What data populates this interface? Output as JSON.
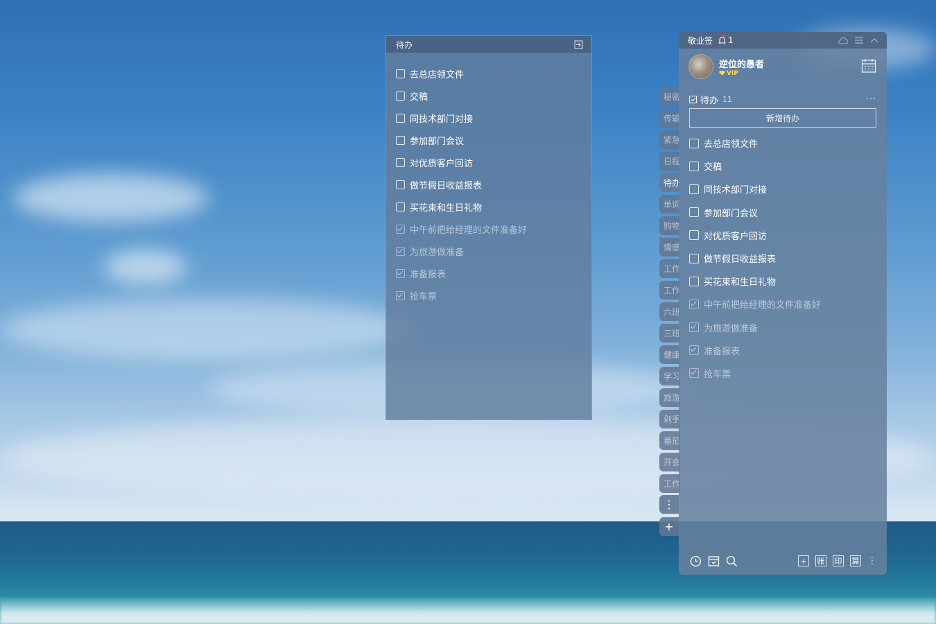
{
  "panel_float": {
    "title": "待办",
    "items": [
      {
        "text": "去总店领文件",
        "done": false
      },
      {
        "text": "交稿",
        "done": false
      },
      {
        "text": "同技术部门对接",
        "done": false
      },
      {
        "text": "参加部门会议",
        "done": false
      },
      {
        "text": "对优质客户回访",
        "done": false
      },
      {
        "text": "做节假日收益报表",
        "done": false
      },
      {
        "text": "买花束和生日礼物",
        "done": false
      },
      {
        "text": "中午前把给经理的文件准备好",
        "done": true
      },
      {
        "text": "为旅游做准备",
        "done": true
      },
      {
        "text": "准备报表",
        "done": true
      },
      {
        "text": "抢车票",
        "done": true
      }
    ]
  },
  "side_tabs": [
    "秘密",
    "传输",
    "紧急",
    "日程",
    "待办",
    "单词",
    "购物",
    "情感",
    "工作",
    "工作",
    "六班",
    "三班",
    "健康",
    "学习",
    "旅游",
    "剁手",
    "番茄",
    "开会",
    "工作"
  ],
  "side_tab_active": 4,
  "side_more": "⋮",
  "side_add": "+",
  "main": {
    "app_title": "敬业签",
    "notif_count": "1",
    "username": "逆位的愚者",
    "vip": "VIP",
    "section_title": "待办",
    "section_count": "11",
    "more": "···",
    "add_button": "新增待办",
    "items": [
      {
        "text": "去总店领文件",
        "done": false
      },
      {
        "text": "交稿",
        "done": false
      },
      {
        "text": "同技术部门对接",
        "done": false
      },
      {
        "text": "参加部门会议",
        "done": false
      },
      {
        "text": "对优质客户回访",
        "done": false
      },
      {
        "text": "做节假日收益报表",
        "done": false
      },
      {
        "text": "买花束和生日礼物",
        "done": false
      },
      {
        "text": "中午前把给经理的文件准备好",
        "done": true
      },
      {
        "text": "为旅游做准备",
        "done": true
      },
      {
        "text": "准备报表",
        "done": true
      },
      {
        "text": "抢车票",
        "done": true
      }
    ],
    "footer_tools": [
      "+",
      "账",
      "印",
      "算"
    ],
    "footer_more": "⋮"
  }
}
